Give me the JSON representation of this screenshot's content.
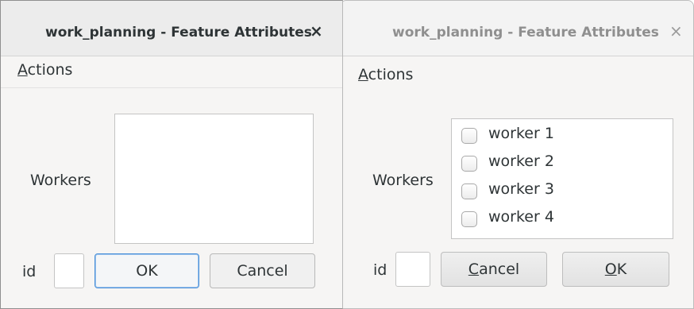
{
  "left_window": {
    "title": "work_planning - Feature Attributes",
    "close_icon": "×",
    "menu": {
      "actions_accel": "A",
      "actions_rest": "ctions"
    },
    "workers_label": "Workers",
    "id_label": "id",
    "id_value": "",
    "ok_label": "OK",
    "cancel_label": "Cancel"
  },
  "right_window": {
    "title": "work_planning - Feature Attributes",
    "close_icon": "×",
    "menu": {
      "actions_accel": "A",
      "actions_rest": "ctions"
    },
    "workers_label": "Workers",
    "workers": [
      {
        "label": "worker 1",
        "checked": false
      },
      {
        "label": "worker 2",
        "checked": false
      },
      {
        "label": "worker 3",
        "checked": false
      },
      {
        "label": "worker 4",
        "checked": false
      }
    ],
    "id_label": "id",
    "id_value": "",
    "cancel_accel": "C",
    "cancel_rest": "ancel",
    "ok_accel": "O",
    "ok_rest": "K"
  },
  "colors": {
    "text": "#2e3436",
    "inactive_title": "#8f8f8f",
    "focus_border": "#4a90d9"
  }
}
